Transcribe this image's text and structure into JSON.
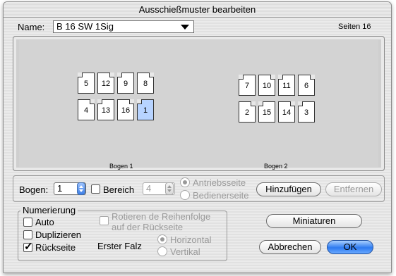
{
  "window": {
    "title": "Ausschießmuster bearbeiten"
  },
  "name_row": {
    "label": "Name:",
    "value": "B 16 SW 1Sig",
    "pages_text": "Seiten 16"
  },
  "layout": {
    "sheets": [
      {
        "label": "Bogen 1",
        "top": [
          "5",
          "12",
          "9",
          "8"
        ],
        "bottom": [
          "4",
          "13",
          "16",
          "1"
        ],
        "selected": "1"
      },
      {
        "label": "Bogen 2",
        "top": [
          "7",
          "10",
          "11",
          "6"
        ],
        "bottom": [
          "2",
          "15",
          "14",
          "3"
        ]
      }
    ]
  },
  "bar": {
    "bogen_label": "Bogen:",
    "bogen_value": "1",
    "bereich_label": "Bereich",
    "bereich_value": "4",
    "antrieb_label": "Antriebsseite",
    "bediener_label": "Bedienerseite",
    "add_label": "Hinzufügen",
    "remove_label": "Entfernen"
  },
  "numbering": {
    "title": "Numerierung",
    "auto_label": "Auto",
    "dup_label": "Duplizieren",
    "back_label": "Rückseite",
    "rotate_label_1": "Rotieren de Reihenfolge",
    "rotate_label_2": "auf der Rückseite",
    "fold_label": "Erster Falz",
    "horizontal_label": "Horizontal",
    "vertical_label": "Vertikal"
  },
  "buttons": {
    "thumbnails": "Miniaturen",
    "cancel": "Abbrechen",
    "ok": "OK"
  },
  "colors": {
    "selected_page": "#b7d3ff",
    "primary_button": "#2d7af0"
  }
}
